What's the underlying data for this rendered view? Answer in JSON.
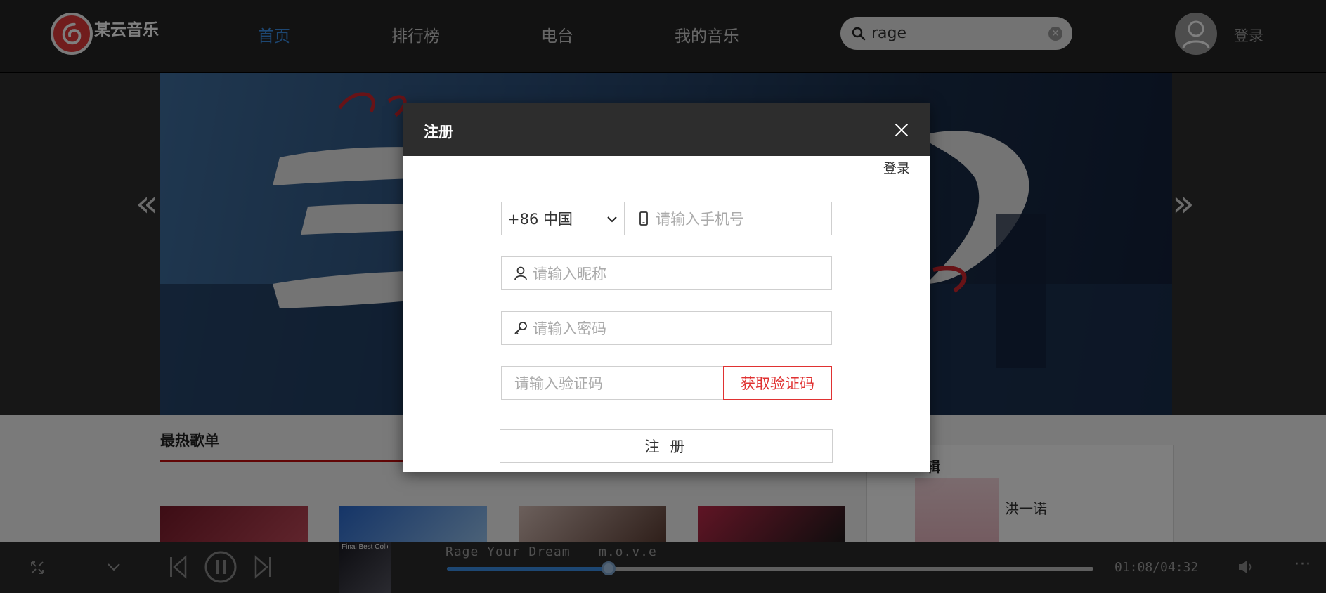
{
  "header": {
    "logo_text": "某云音乐",
    "nav": [
      "首页",
      "排行榜",
      "电台",
      "我的音乐"
    ],
    "search_value": "rage",
    "login_label": "登录"
  },
  "content": {
    "section_title": "最热歌单",
    "side_title": "辑",
    "side_artist": "洪一诺",
    "album_cover_text": "Final Best Collection"
  },
  "player": {
    "song_title": "Rage Your Dream",
    "artist": "m.o.v.e",
    "time": "01:08/04:32",
    "progress": 0.25
  },
  "modal": {
    "title": "注册",
    "login_link": "登录",
    "country": "+86 中国",
    "phone_placeholder": "请输入手机号",
    "nickname_placeholder": "请输入昵称",
    "password_placeholder": "请输入密码",
    "code_placeholder": "请输入验证码",
    "get_code_label": "获取验证码",
    "submit_label": "注 册"
  },
  "colors": {
    "accent_blue": "#3a8ee6",
    "brand_red": "#e33a3a",
    "code_red": "#e03232"
  }
}
